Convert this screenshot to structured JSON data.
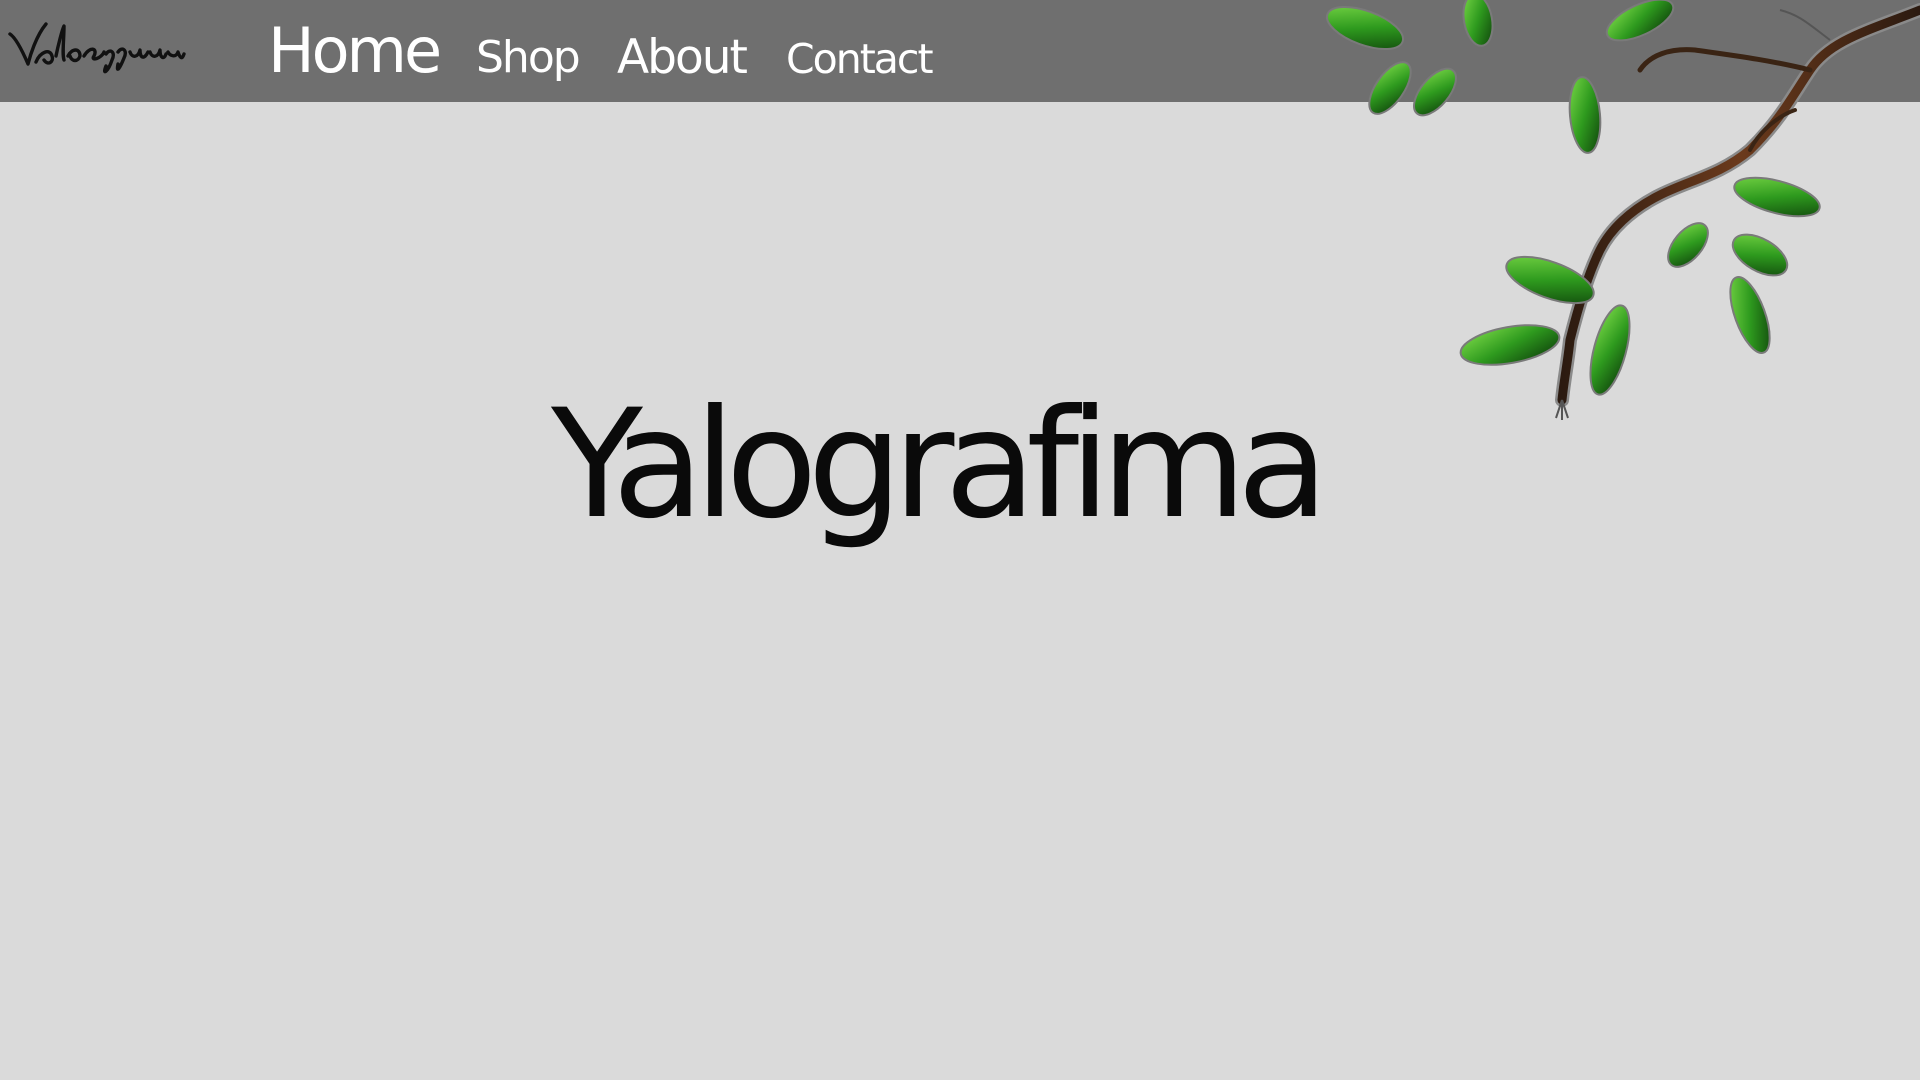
{
  "logo": {
    "signature_text": "Yalografima",
    "color": "#111111"
  },
  "nav": {
    "background": "#6f6f6f",
    "text_color": "#ffffff",
    "items": [
      {
        "label": "Home",
        "active": true
      },
      {
        "label": "Shop",
        "active": false
      },
      {
        "label": "About",
        "active": false
      },
      {
        "label": "Contact",
        "active": false
      }
    ]
  },
  "hero": {
    "title": "Yalografima"
  },
  "decoration": {
    "icon": "tree-branch-with-leaves",
    "leaf_color": "#2e8b1e",
    "branch_color": "#4a2b16"
  },
  "page": {
    "background": "#dadada"
  }
}
